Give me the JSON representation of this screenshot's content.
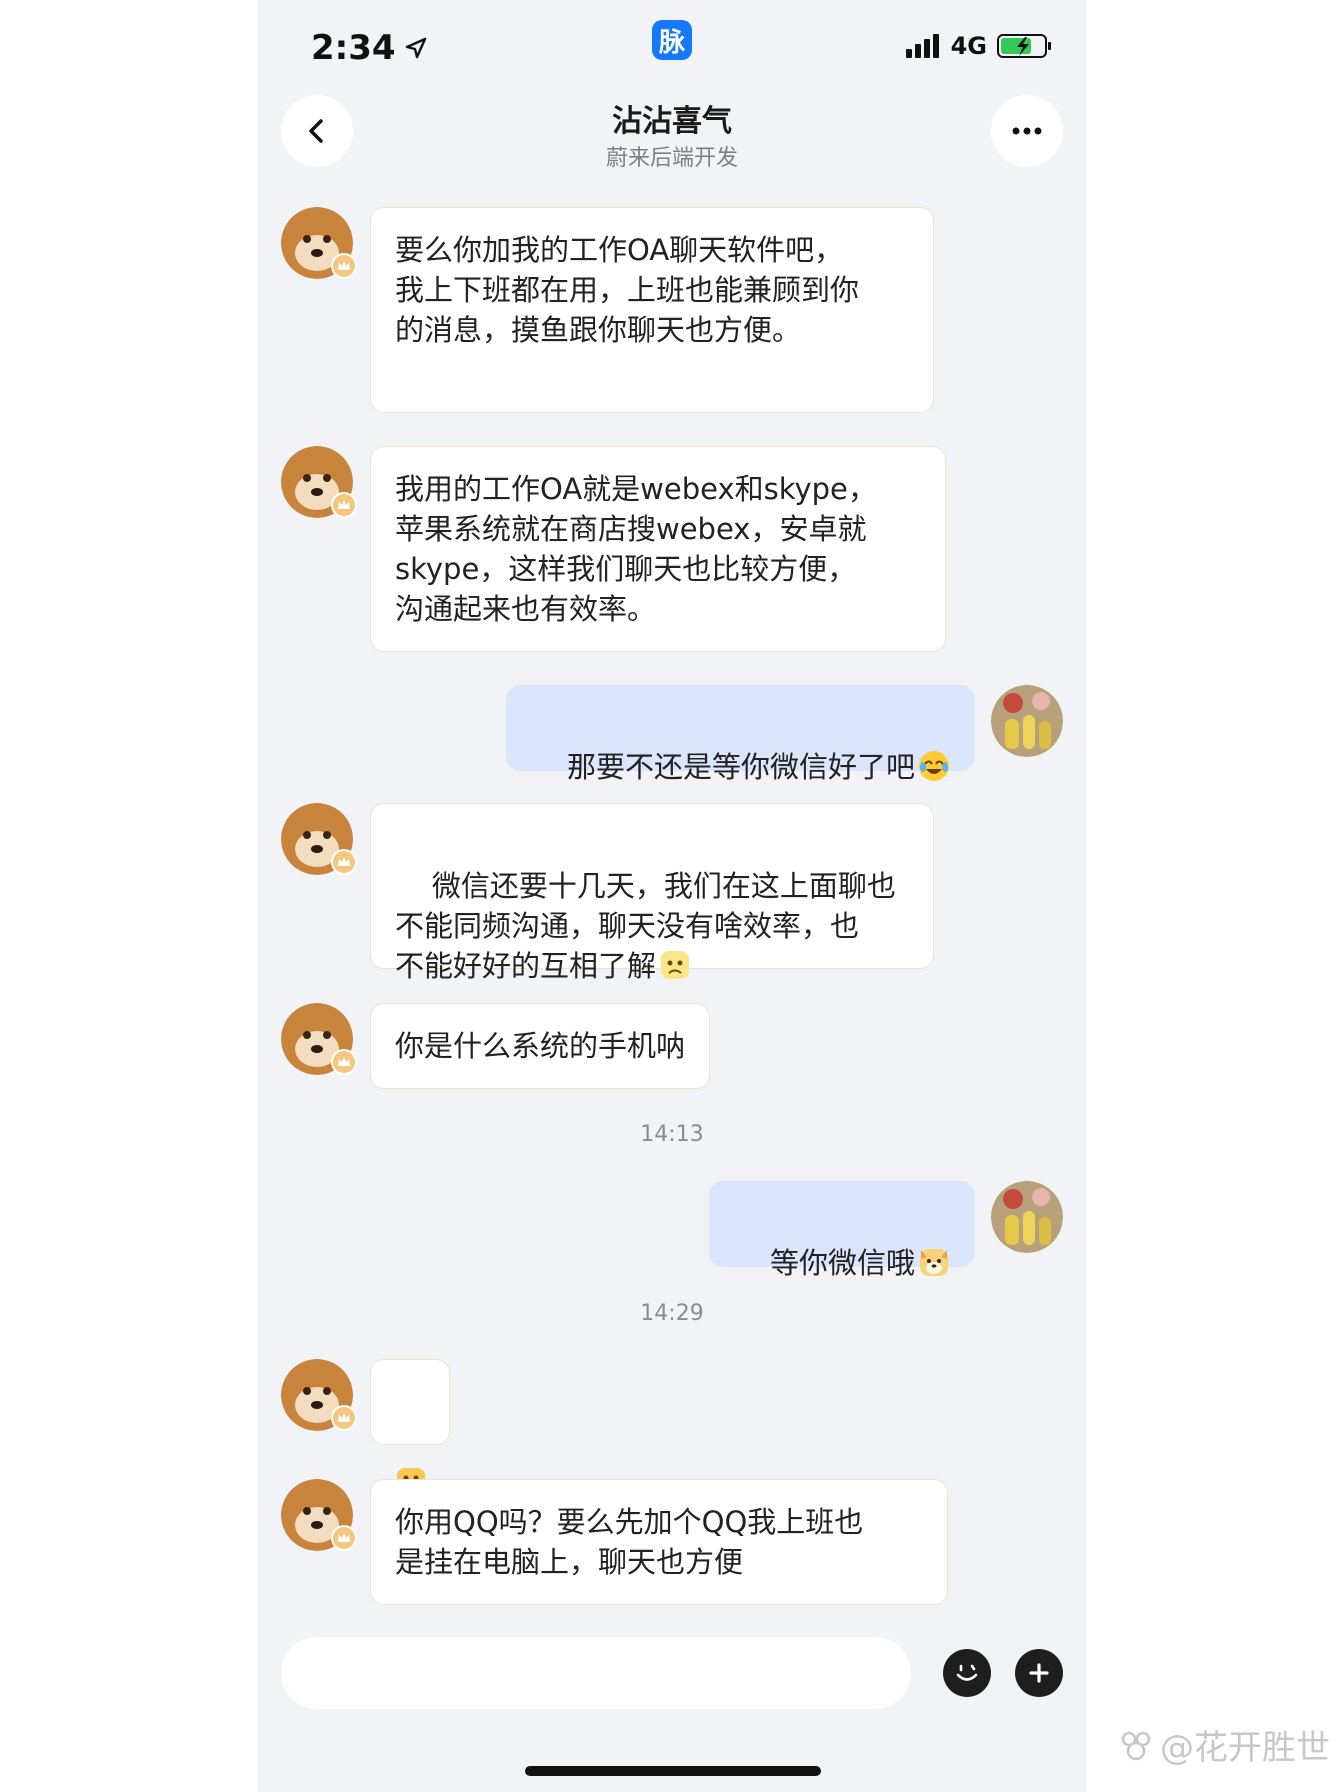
{
  "status": {
    "time": "2:34",
    "app_badge": "脉",
    "network": "4G"
  },
  "header": {
    "title": "沾沾喜气",
    "subtitle": "蔚来后端开发"
  },
  "messages": [
    {
      "text": "要么你加我的工作OA聊天软件吧，\n我上下班都在用，上班也能兼顾到你\n的消息，摸鱼跟你聊天也方便。"
    },
    {
      "text": "我用的工作OA就是webex和skype，\n苹果系统就在商店搜webex，安卓就\nskype，这样我们聊天也比较方便，\n沟通起来也有效率。"
    },
    {
      "text": "那要不还是等你微信好了吧"
    },
    {
      "text": "微信还要十几天，我们在这上面聊也\n不能同频沟通，聊天没有啥效率，也\n不能好好的互相了解"
    },
    {
      "text": "你是什么系统的手机呐"
    },
    {
      "time": "14:13"
    },
    {
      "text": "等你微信哦"
    },
    {
      "time": "14:29"
    },
    {
      "text": ""
    },
    {
      "text": "你用QQ吗？要么先加个QQ我上班也\n是挂在电脑上，聊天也方便"
    }
  ],
  "input": {
    "placeholder": ""
  },
  "watermark": "@花开胜世",
  "colors": {
    "accent": "#1677ff",
    "outgoing_bubble": "#dbe5fb",
    "page_bg": "#f2f3f7"
  },
  "icons": [
    "location-arrow-icon",
    "signal-icon",
    "battery-icon",
    "back-icon",
    "more-icon",
    "emoji-face-icon",
    "plus-icon"
  ]
}
